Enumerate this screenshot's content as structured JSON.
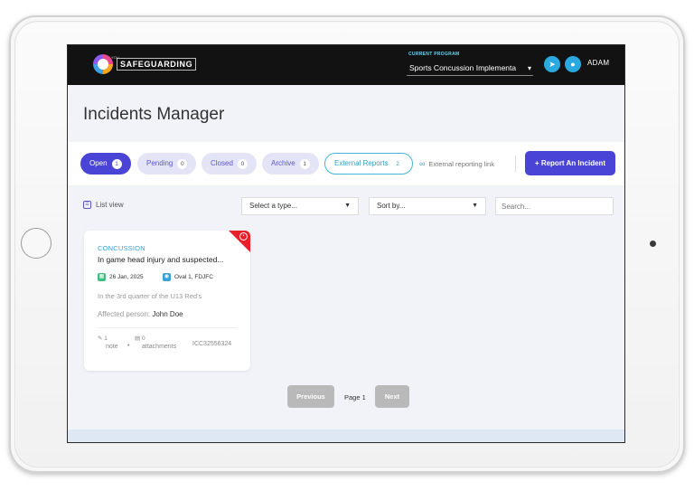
{
  "app": {
    "logo_text": "SAFEGUARDING",
    "logo_sub": "YOU",
    "program_label": "CURRENT PROGRAM",
    "program_value": "Sports Concussion Implementa",
    "user_name": "ADAM"
  },
  "page": {
    "title": "Incidents Manager"
  },
  "tabs": [
    {
      "label": "Open",
      "count": "1",
      "active": true
    },
    {
      "label": "Pending",
      "count": "0",
      "active": false
    },
    {
      "label": "Closed",
      "count": "0",
      "active": false
    },
    {
      "label": "Archive",
      "count": "1",
      "active": false
    },
    {
      "label": "External Reports",
      "count": "2",
      "active": false
    }
  ],
  "external_link_label": "External reporting link",
  "report_button_label": "+ Report An Incident",
  "toolbar": {
    "list_view_label": "List view",
    "type_select": "Select a type...",
    "sort_select": "Sort by...",
    "search_placeholder": "Search..."
  },
  "incident": {
    "type": "CONCUSSION",
    "title": "In game head injury and suspected...",
    "date": "26 Jan, 2025",
    "location": "Oval 1, FDJFC",
    "description": "In the 3rd quarter of the U13 Red's",
    "affected_label": "Affected person:",
    "affected_name": "John Doe",
    "notes_count": "1",
    "notes_label": "note",
    "attachments_count": "0",
    "attachments_label": "attachments",
    "id": "ICC32556324"
  },
  "pagination": {
    "previous": "Previous",
    "page_label": "Page 1",
    "next": "Next"
  },
  "colors": {
    "primary": "#4a44d6",
    "accent": "#29a9e0",
    "alert": "#e8202a",
    "topbar": "#121212"
  }
}
